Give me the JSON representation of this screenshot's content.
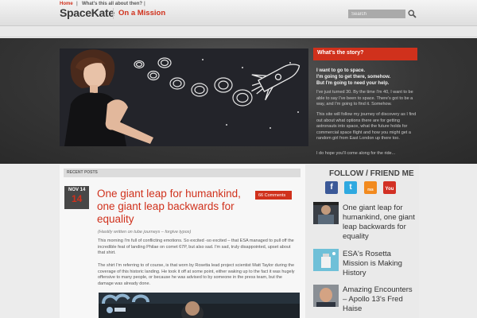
{
  "header": {
    "site_title": "SpaceKate",
    "tagline": "On a Mission",
    "search_placeholder": "Search"
  },
  "nav": {
    "home": "Home",
    "separator": "|",
    "about": "What's this all about then?"
  },
  "story": {
    "title": "What's the story?",
    "intro": "I want to go to space.\nI'm going to get there, somehow.\nBut I'm going to need your help.",
    "p1": "I've just turned 30. By the time I'm 40, I want to be able to say I've been to space. There's got to be a way, and I'm going to find it. Somehow.",
    "p2": "This site will follow my journey of discovery as I find out about what options there are for getting astronauts into space, what the future holds for commercial space flight and how you might get a random girl from East London up there too.",
    "p3": "I do hope you'll come along for the ride..."
  },
  "recent": {
    "heading": "Recent Posts",
    "post": {
      "month": "NOV 14",
      "day": "14",
      "title": "One giant leap for humankind, one giant leap backwards for equality",
      "comments": "66 Comments",
      "subtitle": "(Hastily written on tube journeys – forgive typos)",
      "p1": "This morning I'm full of conflicting emotions. So excited -so excited – that ESA managed to pull off the incredible feat of landing Philae on comet 67P, but also sad. I'm sad, truly disappointed, upset about that shirt.",
      "p2": "The shirt I'm referring to of course, is that worn by Rosetta lead project scientist Matt Taylor during the coverage of this historic landing. He took it off at some point, either waking up to the fact it was hugely offensive to many people, or because he was advised to by someone in the press team, but the damage was already done."
    }
  },
  "sidebar": {
    "follow_title": "FOLLOW / FRIEND ME",
    "social_glyphs": [
      "f",
      "t",
      "rss",
      "You"
    ],
    "posts": [
      {
        "title": "One giant leap for humankind, one giant leap backwards for equality"
      },
      {
        "title": "ESA's Rosetta Mission is Making History"
      },
      {
        "title": "Amazing Encounters – Apollo 13's Fred Haise"
      }
    ]
  },
  "colors": {
    "accent": "#d0311c",
    "hero_bg": "#363636",
    "page_bg": "#ececec"
  }
}
